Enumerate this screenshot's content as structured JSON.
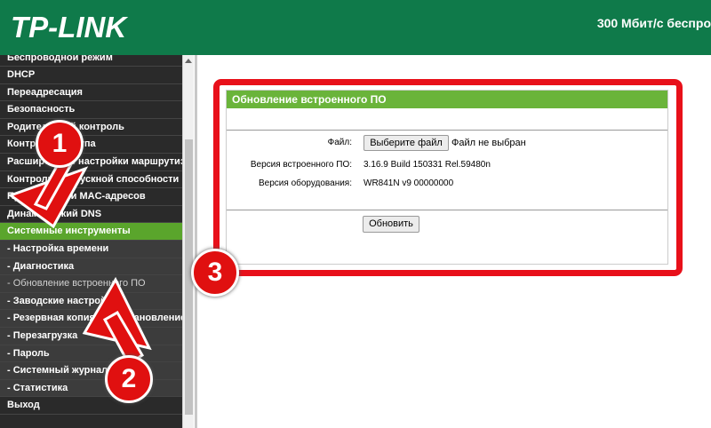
{
  "header": {
    "logo": "TP-LINK",
    "model": "300 Мбит/с беспро"
  },
  "sidebar": {
    "items": [
      {
        "label": "Беспроводной режим"
      },
      {
        "label": "DHCP"
      },
      {
        "label": "Переадресация"
      },
      {
        "label": "Безопасность"
      },
      {
        "label": "Родительский контроль"
      },
      {
        "label": "Контроль доступа"
      },
      {
        "label": "Расширенные настройки маршрутизации"
      },
      {
        "label": "Контроль пропускной способности"
      },
      {
        "label": "Привязка IP- и MAC-адресов"
      },
      {
        "label": "Динамический DNS"
      },
      {
        "label": "Системные инструменты"
      },
      {
        "label": "- Настройка времени"
      },
      {
        "label": "- Диагностика"
      },
      {
        "label": "- Обновление встроенного ПО"
      },
      {
        "label": "- Заводские настройки"
      },
      {
        "label": "- Резервная копия и восстановление"
      },
      {
        "label": "- Перезагрузка"
      },
      {
        "label": "- Пароль"
      },
      {
        "label": "- Системный журнал"
      },
      {
        "label": "- Статистика"
      },
      {
        "label": "Выход"
      }
    ]
  },
  "panel": {
    "title": "Обновление встроенного ПО",
    "file_label": "Файл:",
    "choose_button": "Выберите файл",
    "file_status": "Файл не выбран",
    "fw_version_label": "Версия встроенного ПО:",
    "fw_version_value": "3.16.9 Build 150331 Rel.59480n",
    "hw_version_label": "Версия оборудования:",
    "hw_version_value": "WR841N v9 00000000",
    "update_button": "Обновить"
  },
  "annotations": {
    "badge1": "1",
    "badge2": "2",
    "badge3": "3",
    "color": "#e01010"
  },
  "colors": {
    "header": "#0f7a4a",
    "active_menu": "#5aa52c",
    "panel_title": "#6ab43a",
    "highlight": "#e8101a"
  }
}
